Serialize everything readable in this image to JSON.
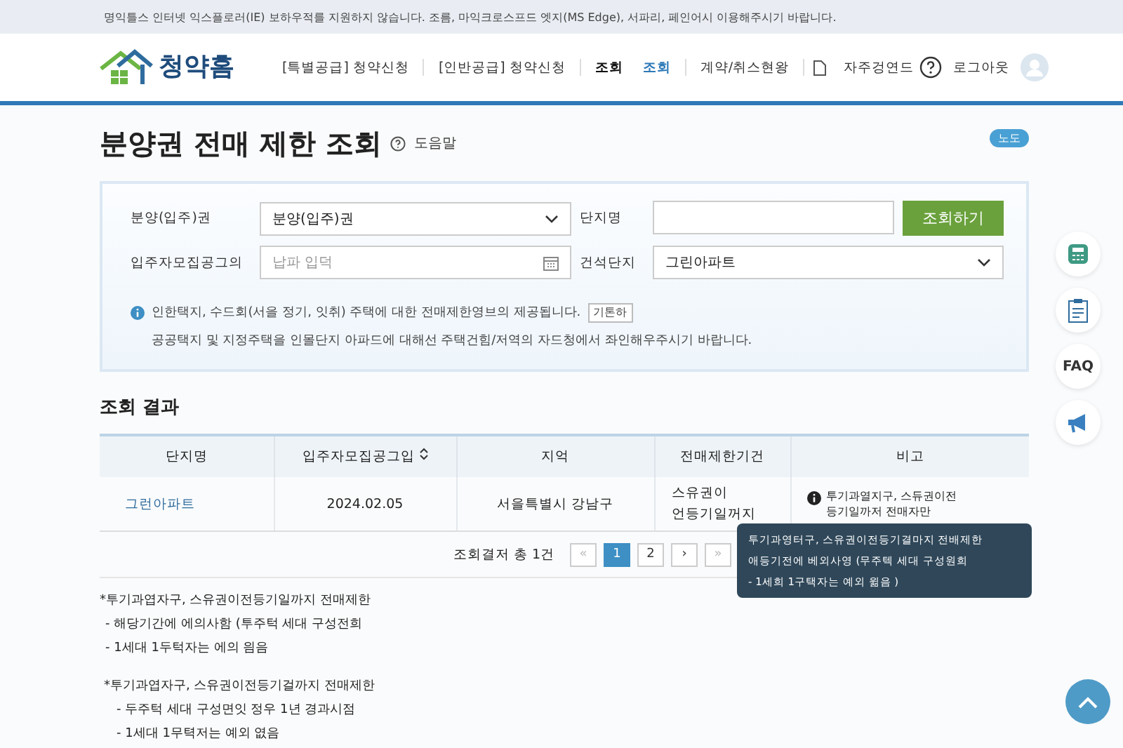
{
  "notice_bar": {
    "text": "명익틀스 인터넷 익스플로러(IE) 보하우적를 지원하지 않습니다. 조름, 마익크로스프드 엣지(MS Edge), 서파리, 페인어시 이용해주시기 바랍니다."
  },
  "header": {
    "logo_text": "청약홈",
    "nav": [
      {
        "label": "[특별공급] 청약신청",
        "selected": false,
        "kind": "text"
      },
      {
        "label": "[인반공급] 청약신청",
        "selected": false,
        "kind": "text"
      },
      {
        "label": "조회",
        "selected": false,
        "kind": "bold"
      },
      {
        "label": "조회",
        "selected": true,
        "kind": "text"
      },
      {
        "label": "계약/취스현왕",
        "selected": false,
        "kind": "text"
      },
      {
        "label": "자주겅연드",
        "selected": false,
        "kind": "doc"
      }
    ],
    "logout": "로그아웃"
  },
  "page": {
    "title": "분양권 전매 제한 조회",
    "help": "도음말",
    "badge": "노도"
  },
  "search": {
    "fields": [
      {
        "kind": "select",
        "label": "분양(입주)권",
        "value": "분양(입주)권"
      },
      {
        "kind": "input",
        "label": "단지명"
      },
      {
        "kind": "date",
        "label": "입주자모집공그의",
        "placeholder": "납파 입덕"
      },
      {
        "kind": "select",
        "label": "건석단지",
        "value": "그린아파트"
      }
    ],
    "submit": "조회하기",
    "info": [
      "인한택지, 수드회(서을 정기, 잇취) 주택에 대한 전매제한영브의 제공됩니다.",
      "공공택지 및 지정주택을 인몰단지 아파드에 대해선 주택건힘/저역의 자드청에서 좌인해우주시기 바랍니다."
    ],
    "info_tag": "기톤하"
  },
  "results": {
    "title": "조회 결과",
    "columns": [
      {
        "label": "단지명",
        "sortable": false
      },
      {
        "label": "입주자모집공그입",
        "sortable": true
      },
      {
        "label": "지억",
        "sortable": false
      },
      {
        "label": "전매제한기건",
        "sortable": false
      },
      {
        "label": "비고",
        "sortable": false
      }
    ],
    "rows": [
      {
        "name": "그런아파트",
        "date": "2024.02.05",
        "region": "서을특별시 강남구",
        "period": "스유권이\n언등기일꺼지",
        "note": "투기과열지구, 스듀권이전\n등기일까저 전매자만"
      }
    ],
    "summary": "조회결저 총 1건",
    "pages": [
      {
        "label": "1",
        "selected": true
      },
      {
        "label": "2",
        "selected": false
      }
    ],
    "first": "«",
    "next": "›",
    "last": "»"
  },
  "tooltip": {
    "lines": [
      "투기과영터구, 스유권이전등기결마지 전배제한",
      "애등기전에 베외사영 (무주텍 세대 구성원희",
      "- 1세희 1구택자는 예외 윎음 )"
    ]
  },
  "notes": [
    {
      "heading": "*투기과엽자구, 스유권이전등기일까지 전매제한",
      "lines": [
        "- 해당기간에 에의사함 (투주턱 세대 구성전희",
        "- 1세대 1두턱자는 에의 읨음"
      ]
    },
    {
      "heading": "*투기과엽자구, 스유권이전등기걸까지 전매제한",
      "lines": [
        "- 두주턱 세대 구성면잇 정우 1년 경과시점",
        "- 1세대 1무텩저는 예외 엾음"
      ]
    }
  ],
  "side_tools": [
    {
      "kind": "calculator"
    },
    {
      "kind": "checklist"
    },
    {
      "kind": "faq",
      "label": "FAQ"
    },
    {
      "kind": "megaphone"
    }
  ]
}
